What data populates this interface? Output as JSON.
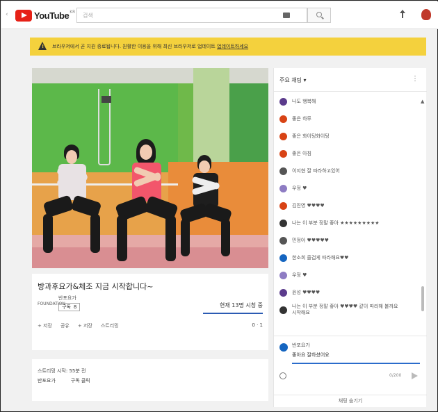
{
  "header": {
    "logo_text": "YouTube",
    "logo_sup": "KR",
    "search_value": "검색",
    "icons": [
      "menu-icon",
      "keyboard-icon",
      "search-icon",
      "upload-icon",
      "avatar"
    ]
  },
  "warning": {
    "icon": "warning-icon",
    "text": "브라우저에서 곧 지원 종료됩니다. 원활한 이용을 위해 최신 브라우저로 업데이트",
    "link": "업데이트하세요"
  },
  "video": {
    "title": "방과후요가&체조 지금 시작합니다~",
    "channel_logo_text": "FOUNDATION",
    "channel_name": "반포요가",
    "subscribe_label": "구독",
    "subscribe_count": "8",
    "views": "현재 13명 시청 중",
    "actions": [
      "+ 저장",
      "공유",
      "+ 저장",
      "스트리밍"
    ],
    "likes": "0 · 1"
  },
  "description": {
    "line1": "스트리밍 시작: 55분 전",
    "line2_a": "반포요가",
    "line2_b": "구독 클릭"
  },
  "chat": {
    "title": "주요 채팅",
    "messages": [
      {
        "color": "#5b3b8c",
        "text": "나도 행복해"
      },
      {
        "color": "#d84315",
        "text": "좋은 하루"
      },
      {
        "color": "#d84315",
        "text": "좋은 화이팅화이팅"
      },
      {
        "color": "#d84315",
        "text": "좋은 아침"
      },
      {
        "color": "#555555",
        "text": "이지현 잘 따라하고있어"
      },
      {
        "color": "#8e7cc3",
        "text": "우정 ♥"
      },
      {
        "color": "#d84315",
        "text": "김진영 ♥♥♥♥"
      },
      {
        "color": "#333333",
        "text": "나는 이 부분 정말 좋아 ★★★★★★★★★"
      },
      {
        "color": "#555555",
        "text": "민정아 ♥♥♥♥♥"
      },
      {
        "color": "#1565c0",
        "text": "한소희 즐겁게 따라해요♥♥"
      },
      {
        "color": "#8e7cc3",
        "text": "우정 ♥"
      },
      {
        "color": "#5b3b8c",
        "text": "윤성 ♥♥♥♥"
      },
      {
        "color": "#333333",
        "text": "나는 이 부분 정말 좋아 ♥♥♥♥ 같이 따라해 볼까요",
        "text2": "시작해요"
      }
    ],
    "me_name": "반포요가",
    "input_value": "좋아요 잘하셨어요",
    "char_count": "0/200",
    "footer": "채팅 숨기기"
  }
}
